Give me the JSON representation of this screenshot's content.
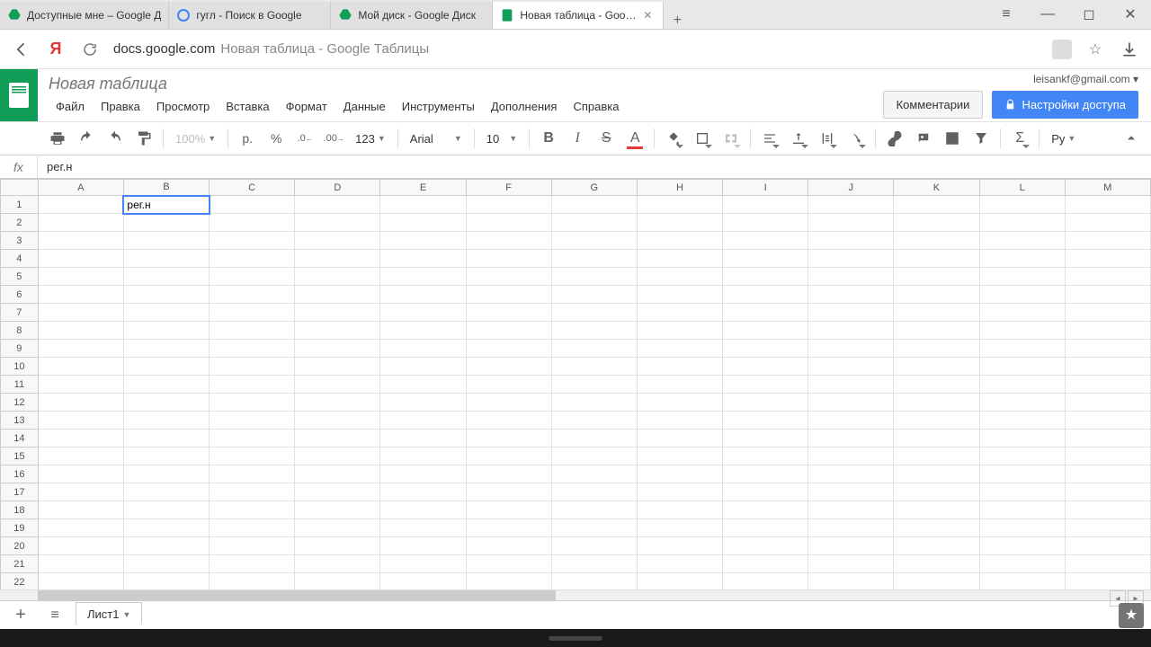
{
  "browser": {
    "tabs": [
      {
        "title": "Доступные мне – Google Д",
        "icon_color": "#0f9d58"
      },
      {
        "title": "гугл - Поиск в Google",
        "icon_color": "#4285f4"
      },
      {
        "title": "Мой диск - Google Диск",
        "icon_color": "#0f9d58"
      },
      {
        "title": "Новая таблица - Google",
        "icon_color": "#0f9d58",
        "active": true
      }
    ],
    "url_domain": "docs.google.com",
    "url_path": "Новая таблица - Google Таблицы"
  },
  "doc": {
    "title": "Новая таблица",
    "menus": [
      "Файл",
      "Правка",
      "Просмотр",
      "Вставка",
      "Формат",
      "Данные",
      "Инструменты",
      "Дополнения",
      "Справка"
    ],
    "user_email": "leisankf@gmail.com",
    "comments_label": "Комментарии",
    "share_label": "Настройки доступа"
  },
  "toolbar": {
    "zoom": "100%",
    "currency": "р.",
    "percent": "%",
    "dec_dec": ".0",
    "inc_dec": ".00",
    "more_formats": "123",
    "font": "Arial",
    "font_size": "10",
    "lang": "Ру"
  },
  "formula": {
    "value": "рег.н"
  },
  "sheet": {
    "columns": [
      "A",
      "B",
      "C",
      "D",
      "E",
      "F",
      "G",
      "H",
      "I",
      "J",
      "K",
      "L",
      "M"
    ],
    "row_count": 22,
    "active_cell": {
      "row": 1,
      "col": "B",
      "value": "рег.н"
    },
    "tab_name": "Лист1"
  }
}
